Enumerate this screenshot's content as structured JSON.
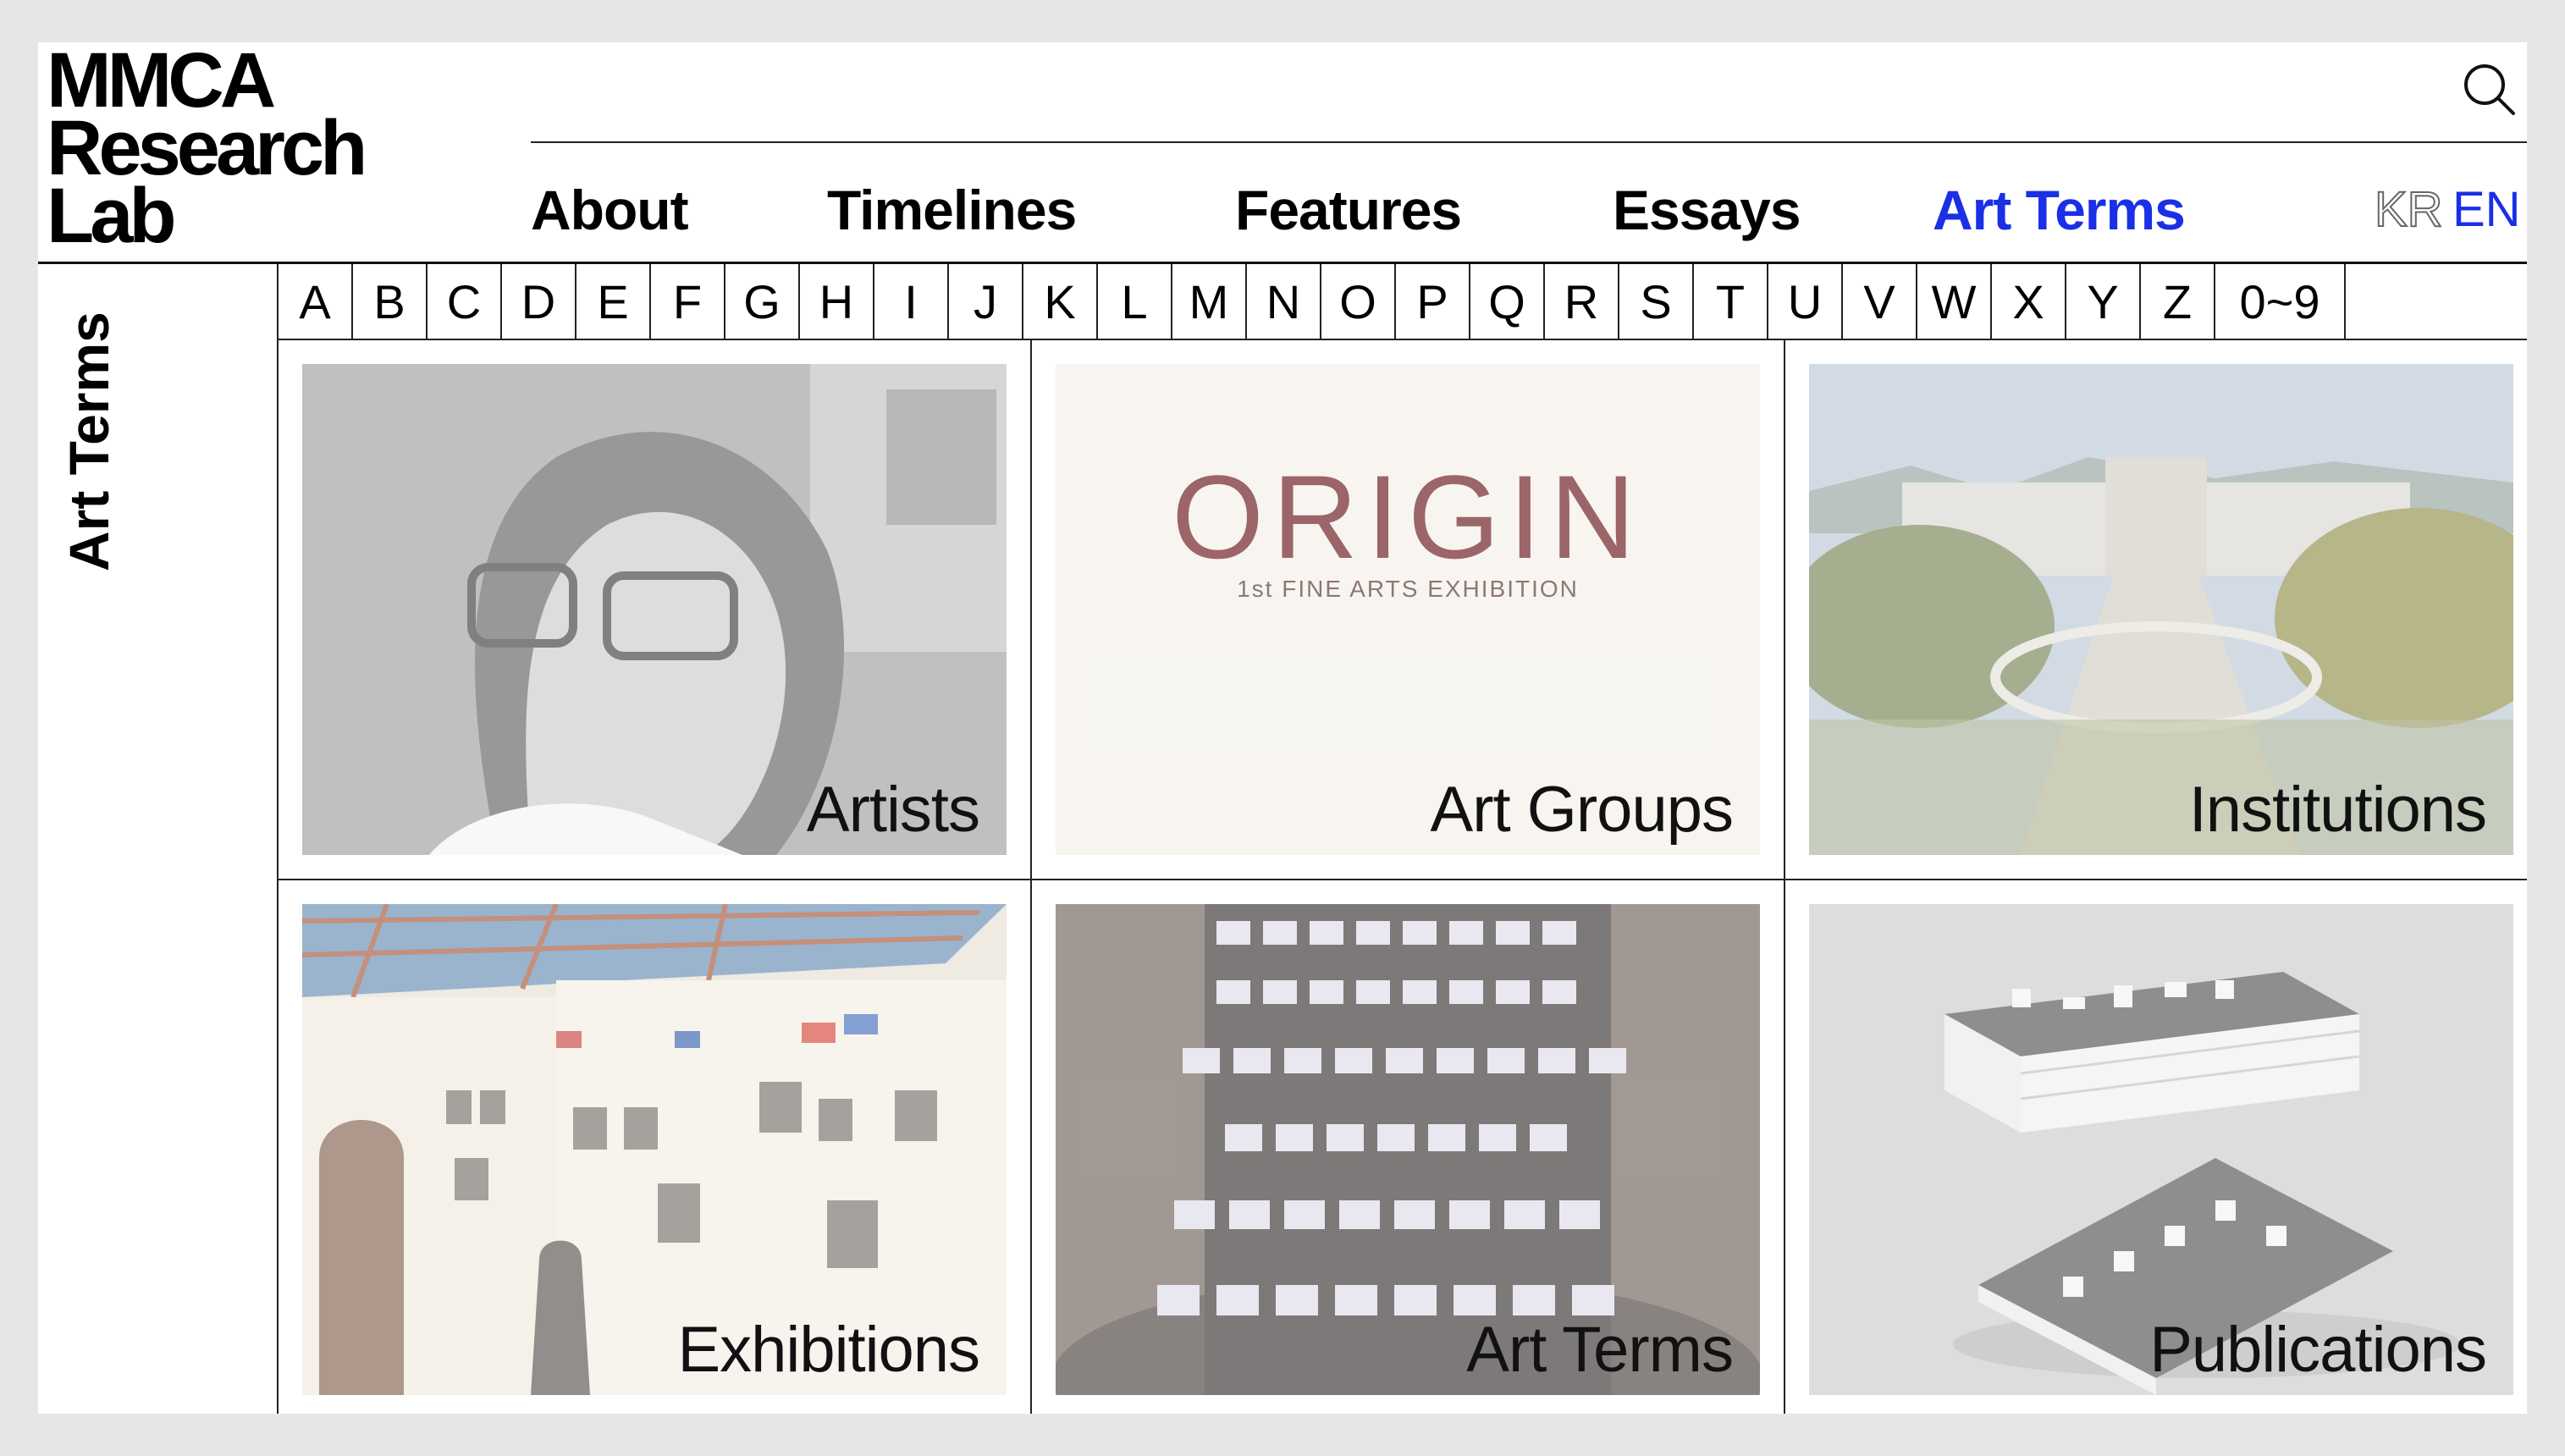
{
  "logo": {
    "line1": "MMCA",
    "line2": "Research",
    "line3": "Lab"
  },
  "search": {
    "icon": "search-icon"
  },
  "nav": {
    "items": [
      {
        "label": "About"
      },
      {
        "label": "Timelines"
      },
      {
        "label": "Features"
      },
      {
        "label": "Essays"
      },
      {
        "label": "Art Terms"
      }
    ],
    "active": "Art Terms",
    "active_color": "#1a2fe6"
  },
  "lang": {
    "kr": "KR",
    "en": "EN"
  },
  "sidebar": {
    "title": "Art Terms"
  },
  "alphabet": [
    "A",
    "B",
    "C",
    "D",
    "E",
    "F",
    "G",
    "H",
    "I",
    "J",
    "K",
    "L",
    "M",
    "N",
    "O",
    "P",
    "Q",
    "R",
    "S",
    "T",
    "U",
    "V",
    "W",
    "X",
    "Y",
    "Z",
    "0~9"
  ],
  "categories": [
    {
      "label": "Artists"
    },
    {
      "label": "Art Groups",
      "image_text": {
        "title": "ORIGIN",
        "subtitle": "1st FINE ARTS EXHIBITION"
      }
    },
    {
      "label": "Institutions"
    },
    {
      "label": "Exhibitions"
    },
    {
      "label": "Art Terms"
    },
    {
      "label": "Publications"
    }
  ]
}
